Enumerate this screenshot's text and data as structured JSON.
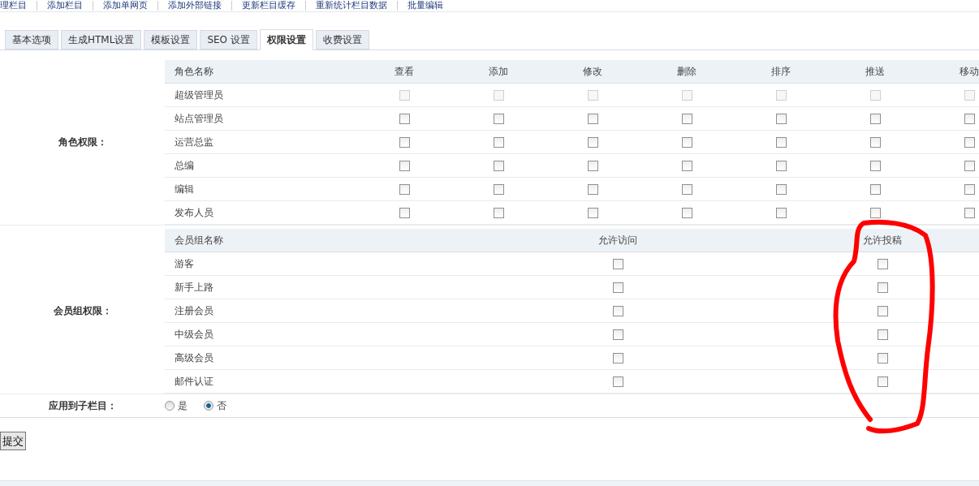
{
  "nav_links": [
    "理栏目",
    "添加栏目",
    "添加单网页",
    "添加外部链接",
    "更新栏目缓存",
    "重新统计栏目数据",
    "批量编辑"
  ],
  "tabs": [
    {
      "label": "基本选项",
      "selected": false
    },
    {
      "label": "生成HTML设置",
      "selected": false
    },
    {
      "label": "模板设置",
      "selected": false
    },
    {
      "label": "SEO 设置",
      "selected": false
    },
    {
      "label": "权限设置",
      "selected": true
    },
    {
      "label": "收费设置",
      "selected": false
    }
  ],
  "role_permissions": {
    "label": "角色权限：",
    "columns": [
      "角色名称",
      "查看",
      "添加",
      "修改",
      "删除",
      "排序",
      "推送",
      "移动"
    ],
    "rows": [
      {
        "name": "超级管理员",
        "disabled": true,
        "checks": [
          false,
          false,
          false,
          false,
          false,
          false,
          false
        ]
      },
      {
        "name": "站点管理员",
        "disabled": false,
        "checks": [
          false,
          false,
          false,
          false,
          false,
          false,
          false
        ]
      },
      {
        "name": "运营总监",
        "disabled": false,
        "checks": [
          false,
          false,
          false,
          false,
          false,
          false,
          false
        ]
      },
      {
        "name": "总编",
        "disabled": false,
        "checks": [
          false,
          false,
          false,
          false,
          false,
          false,
          false
        ]
      },
      {
        "name": "编辑",
        "disabled": false,
        "checks": [
          false,
          false,
          false,
          false,
          false,
          false,
          false
        ]
      },
      {
        "name": "发布人员",
        "disabled": false,
        "checks": [
          false,
          false,
          false,
          false,
          false,
          false,
          false
        ]
      }
    ]
  },
  "member_permissions": {
    "label": "会员组权限：",
    "columns": [
      "会员组名称",
      "允许访问",
      "允许投稿"
    ],
    "rows": [
      {
        "name": "游客",
        "checks": [
          false,
          false
        ]
      },
      {
        "name": "新手上路",
        "checks": [
          false,
          false
        ]
      },
      {
        "name": "注册会员",
        "checks": [
          false,
          false
        ]
      },
      {
        "name": "中级会员",
        "checks": [
          false,
          false
        ]
      },
      {
        "name": "高级会员",
        "checks": [
          false,
          false
        ]
      },
      {
        "name": "邮件认证",
        "checks": [
          false,
          false
        ]
      }
    ]
  },
  "apply_to_children": {
    "label": "应用到子栏目：",
    "options": [
      {
        "label": "是",
        "selected": false
      },
      {
        "label": "否",
        "selected": true
      }
    ]
  },
  "submit_button": "提交"
}
